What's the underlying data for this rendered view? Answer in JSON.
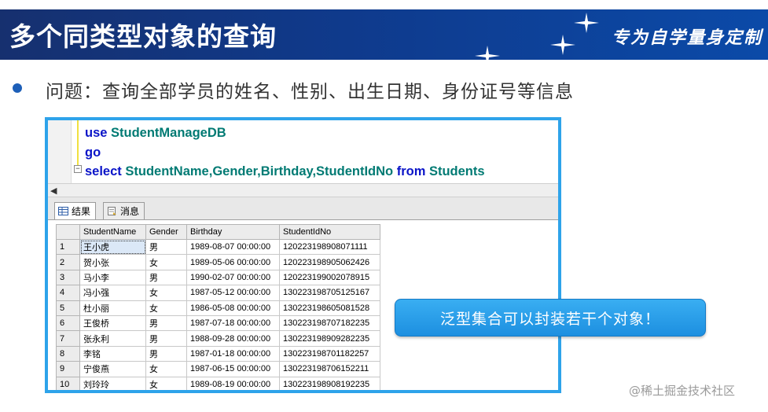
{
  "banner": {
    "title": "多个同类型对象的查询",
    "slogan": "专为自学量身定制"
  },
  "bullet": {
    "text": "问题：查询全部学员的姓名、性别、出生日期、身份证号等信息"
  },
  "editor": {
    "lines": [
      {
        "keyword": "use",
        "rest": " StudentManageDB"
      },
      {
        "keyword": "go",
        "rest": ""
      },
      {
        "keyword": "select",
        "rest": " StudentName,Gender,Birthday,StudentIdNo ",
        "keyword2": "from",
        "rest2": " Students"
      }
    ]
  },
  "tabs": {
    "results_label": "结果",
    "messages_label": "消息"
  },
  "results": {
    "columns": [
      "StudentName",
      "Gender",
      "Birthday",
      "StudentIdNo"
    ],
    "rows": [
      {
        "num": "1",
        "name": "王小虎",
        "gender": "男",
        "birthday": "1989-08-07 00:00:00",
        "id": "120223198908071111"
      },
      {
        "num": "2",
        "name": "贺小张",
        "gender": "女",
        "birthday": "1989-05-06 00:00:00",
        "id": "120223198905062426"
      },
      {
        "num": "3",
        "name": "马小李",
        "gender": "男",
        "birthday": "1990-02-07 00:00:00",
        "id": "120223199002078915"
      },
      {
        "num": "4",
        "name": "冯小强",
        "gender": "女",
        "birthday": "1987-05-12 00:00:00",
        "id": "130223198705125167"
      },
      {
        "num": "5",
        "name": "杜小丽",
        "gender": "女",
        "birthday": "1986-05-08 00:00:00",
        "id": "130223198605081528"
      },
      {
        "num": "6",
        "name": "王俊桥",
        "gender": "男",
        "birthday": "1987-07-18 00:00:00",
        "id": "130223198707182235"
      },
      {
        "num": "7",
        "name": "张永利",
        "gender": "男",
        "birthday": "1988-09-28 00:00:00",
        "id": "130223198909282235"
      },
      {
        "num": "8",
        "name": "李铭",
        "gender": "男",
        "birthday": "1987-01-18 00:00:00",
        "id": "130223198701182257"
      },
      {
        "num": "9",
        "name": "宁俊燕",
        "gender": "女",
        "birthday": "1987-06-15 00:00:00",
        "id": "130223198706152211"
      },
      {
        "num": "10",
        "name": "刘玲玲",
        "gender": "女",
        "birthday": "1989-08-19 00:00:00",
        "id": "130223198908192235"
      }
    ]
  },
  "callout": {
    "text": "泛型集合可以封装若干个对象！"
  },
  "watermark": {
    "text": "@稀土掘金技术社区"
  },
  "colors": {
    "banner": "#0f3a8c",
    "frame": "#2ea3ea",
    "keyword": "#0a14c8",
    "identifier": "#007a73",
    "callout": "#1d8fe0"
  }
}
